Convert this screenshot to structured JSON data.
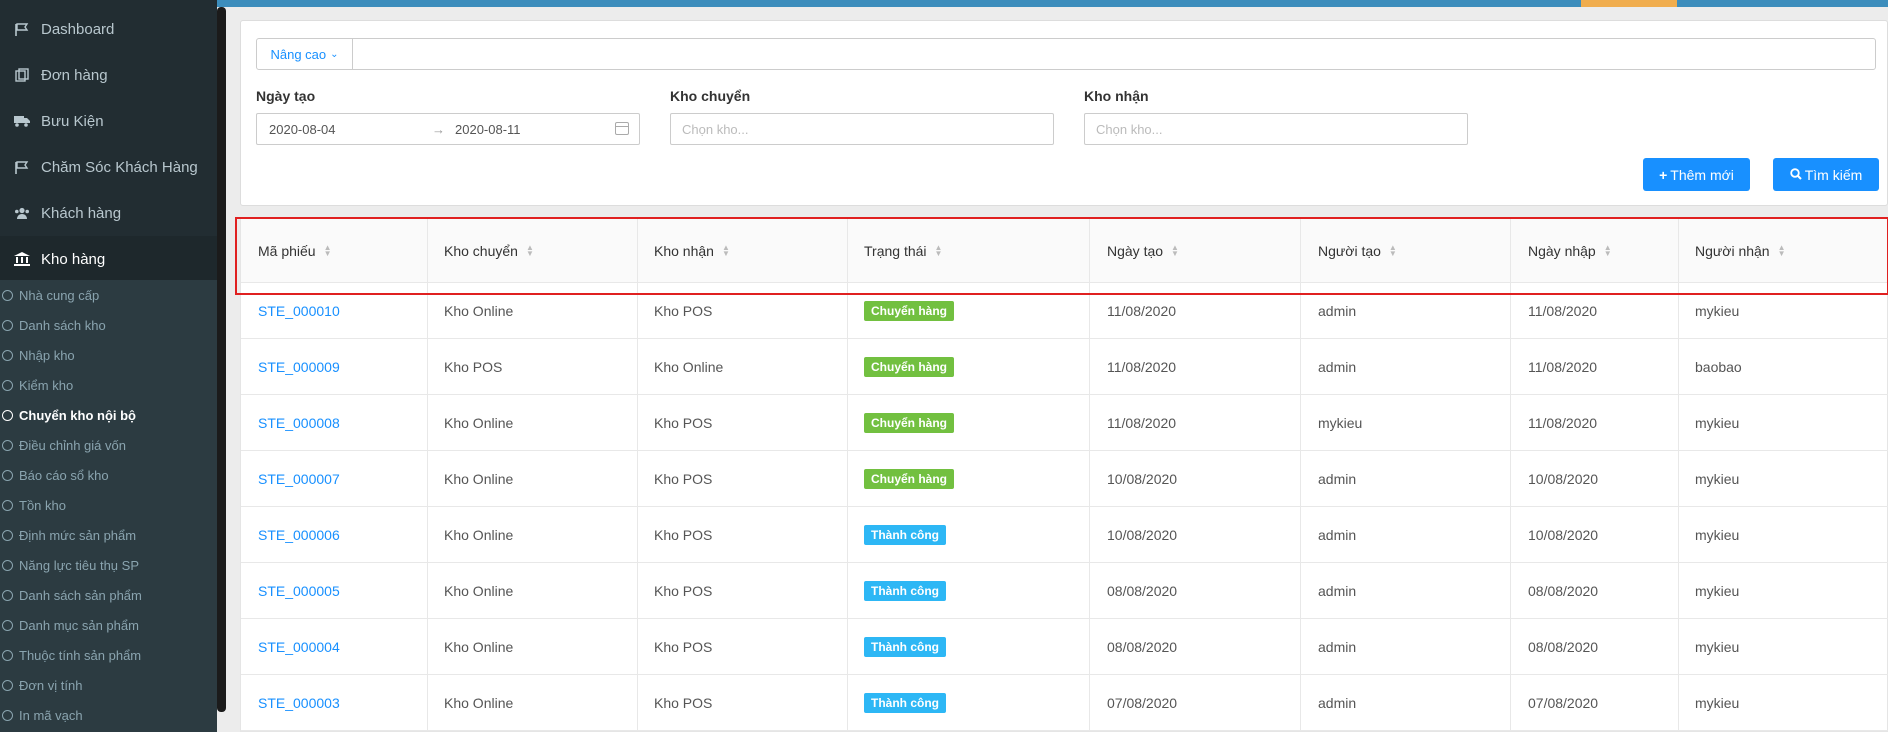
{
  "sidebar": {
    "items": [
      {
        "label": "Dashboard",
        "icon": "flag-icon"
      },
      {
        "label": "Đơn hàng",
        "icon": "orders-icon"
      },
      {
        "label": "Bưu Kiện",
        "icon": "truck-icon"
      },
      {
        "label": "Chăm Sóc Khách Hàng",
        "icon": "flag-icon"
      },
      {
        "label": "Khách hàng",
        "icon": "users-icon"
      },
      {
        "label": "Kho hàng",
        "icon": "warehouse-icon"
      }
    ],
    "subitems": [
      "Nhà cung cấp",
      "Danh sách kho",
      "Nhập kho",
      "Kiểm kho",
      "Chuyển kho nội bộ",
      "Điều chỉnh giá vốn",
      "Báo cáo sổ kho",
      "Tồn kho",
      "Định mức sản phẩm",
      "Năng lực tiêu thụ SP",
      "Danh sách sản phẩm",
      "Danh mục sản phẩm",
      "Thuộc tính sản phẩm",
      "Đơn vị tính",
      "In mã vạch"
    ]
  },
  "filter": {
    "advanced_label": "Nâng cao",
    "date_label": "Ngày tạo",
    "date_from": "2020-08-04",
    "date_to": "2020-08-11",
    "from_label": "Kho chuyển",
    "from_placeholder": "Chọn kho...",
    "to_label": "Kho nhận",
    "to_placeholder": "Chọn kho...",
    "add_button": "Thêm mới",
    "search_button": "Tìm kiếm"
  },
  "table": {
    "columns": [
      "Mã phiếu",
      "Kho chuyển",
      "Kho nhận",
      "Trạng thái",
      "Ngày tạo",
      "Người tạo",
      "Ngày nhập",
      "Người nhận"
    ],
    "rows": [
      {
        "code": "STE_000010",
        "from": "Kho Online",
        "to": "Kho POS",
        "status": "Chuyển hàng",
        "created": "11/08/2020",
        "creator": "admin",
        "imported": "11/08/2020",
        "receiver": "mykieu"
      },
      {
        "code": "STE_000009",
        "from": "Kho POS",
        "to": "Kho Online",
        "status": "Chuyển hàng",
        "created": "11/08/2020",
        "creator": "admin",
        "imported": "11/08/2020",
        "receiver": "baobao"
      },
      {
        "code": "STE_000008",
        "from": "Kho Online",
        "to": "Kho POS",
        "status": "Chuyển hàng",
        "created": "11/08/2020",
        "creator": "mykieu",
        "imported": "11/08/2020",
        "receiver": "mykieu"
      },
      {
        "code": "STE_000007",
        "from": "Kho Online",
        "to": "Kho POS",
        "status": "Chuyển hàng",
        "created": "10/08/2020",
        "creator": "admin",
        "imported": "10/08/2020",
        "receiver": "mykieu"
      },
      {
        "code": "STE_000006",
        "from": "Kho Online",
        "to": "Kho POS",
        "status": "Thành công",
        "created": "10/08/2020",
        "creator": "admin",
        "imported": "10/08/2020",
        "receiver": "mykieu"
      },
      {
        "code": "STE_000005",
        "from": "Kho Online",
        "to": "Kho POS",
        "status": "Thành công",
        "created": "08/08/2020",
        "creator": "admin",
        "imported": "08/08/2020",
        "receiver": "mykieu"
      },
      {
        "code": "STE_000004",
        "from": "Kho Online",
        "to": "Kho POS",
        "status": "Thành công",
        "created": "08/08/2020",
        "creator": "admin",
        "imported": "08/08/2020",
        "receiver": "mykieu"
      },
      {
        "code": "STE_000003",
        "from": "Kho Online",
        "to": "Kho POS",
        "status": "Thành công",
        "created": "07/08/2020",
        "creator": "admin",
        "imported": "07/08/2020",
        "receiver": "mykieu"
      }
    ]
  },
  "colors": {
    "sidebar_bg": "#222d32",
    "accent": "#1890ff",
    "status_transfer": "#72c040",
    "status_success": "#2db7f5",
    "highlight_border": "#e02020"
  }
}
